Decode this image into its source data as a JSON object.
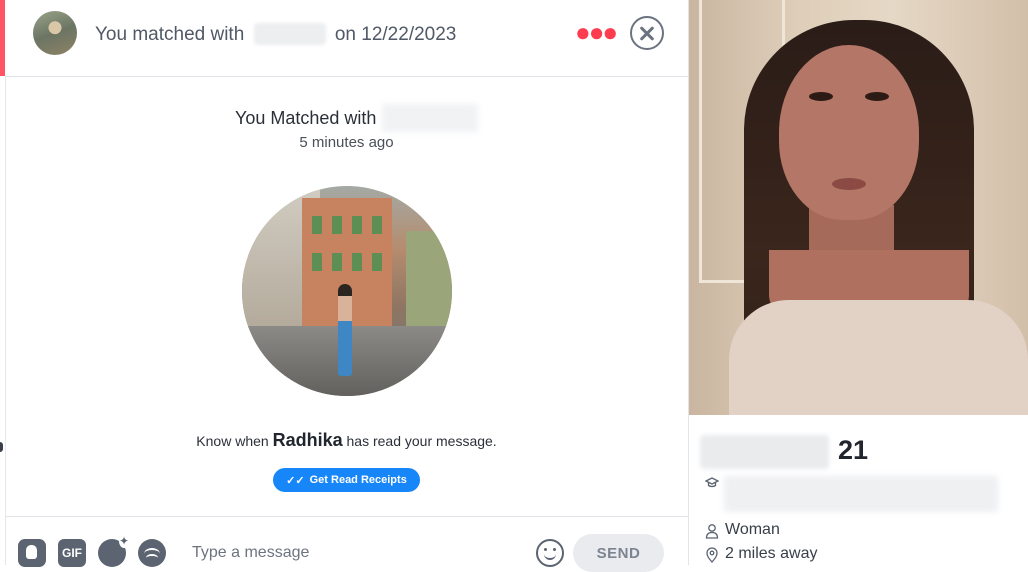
{
  "header": {
    "matched_prefix": "You matched with",
    "matched_suffix": "on 12/22/2023",
    "more_icon": "more-dots-icon",
    "close_icon": "close-circle-icon",
    "accent_color": "#fd5564"
  },
  "match": {
    "title": "You Matched with",
    "time": "5 minutes ago",
    "know_prefix": "Know when",
    "name": "Radhika",
    "know_suffix": "has read your message.",
    "receipts_label": "Get Read Receipts",
    "receipts_color": "#1786f8"
  },
  "composer": {
    "placeholder": "Type a message",
    "gif_label": "GIF",
    "send_label": "SEND",
    "icons": [
      "contact-card-icon",
      "gif-icon",
      "sticker-icon",
      "spotify-icon",
      "emoji-icon"
    ]
  },
  "profile": {
    "age": "21",
    "gender": "Woman",
    "distance": "2 miles away"
  }
}
